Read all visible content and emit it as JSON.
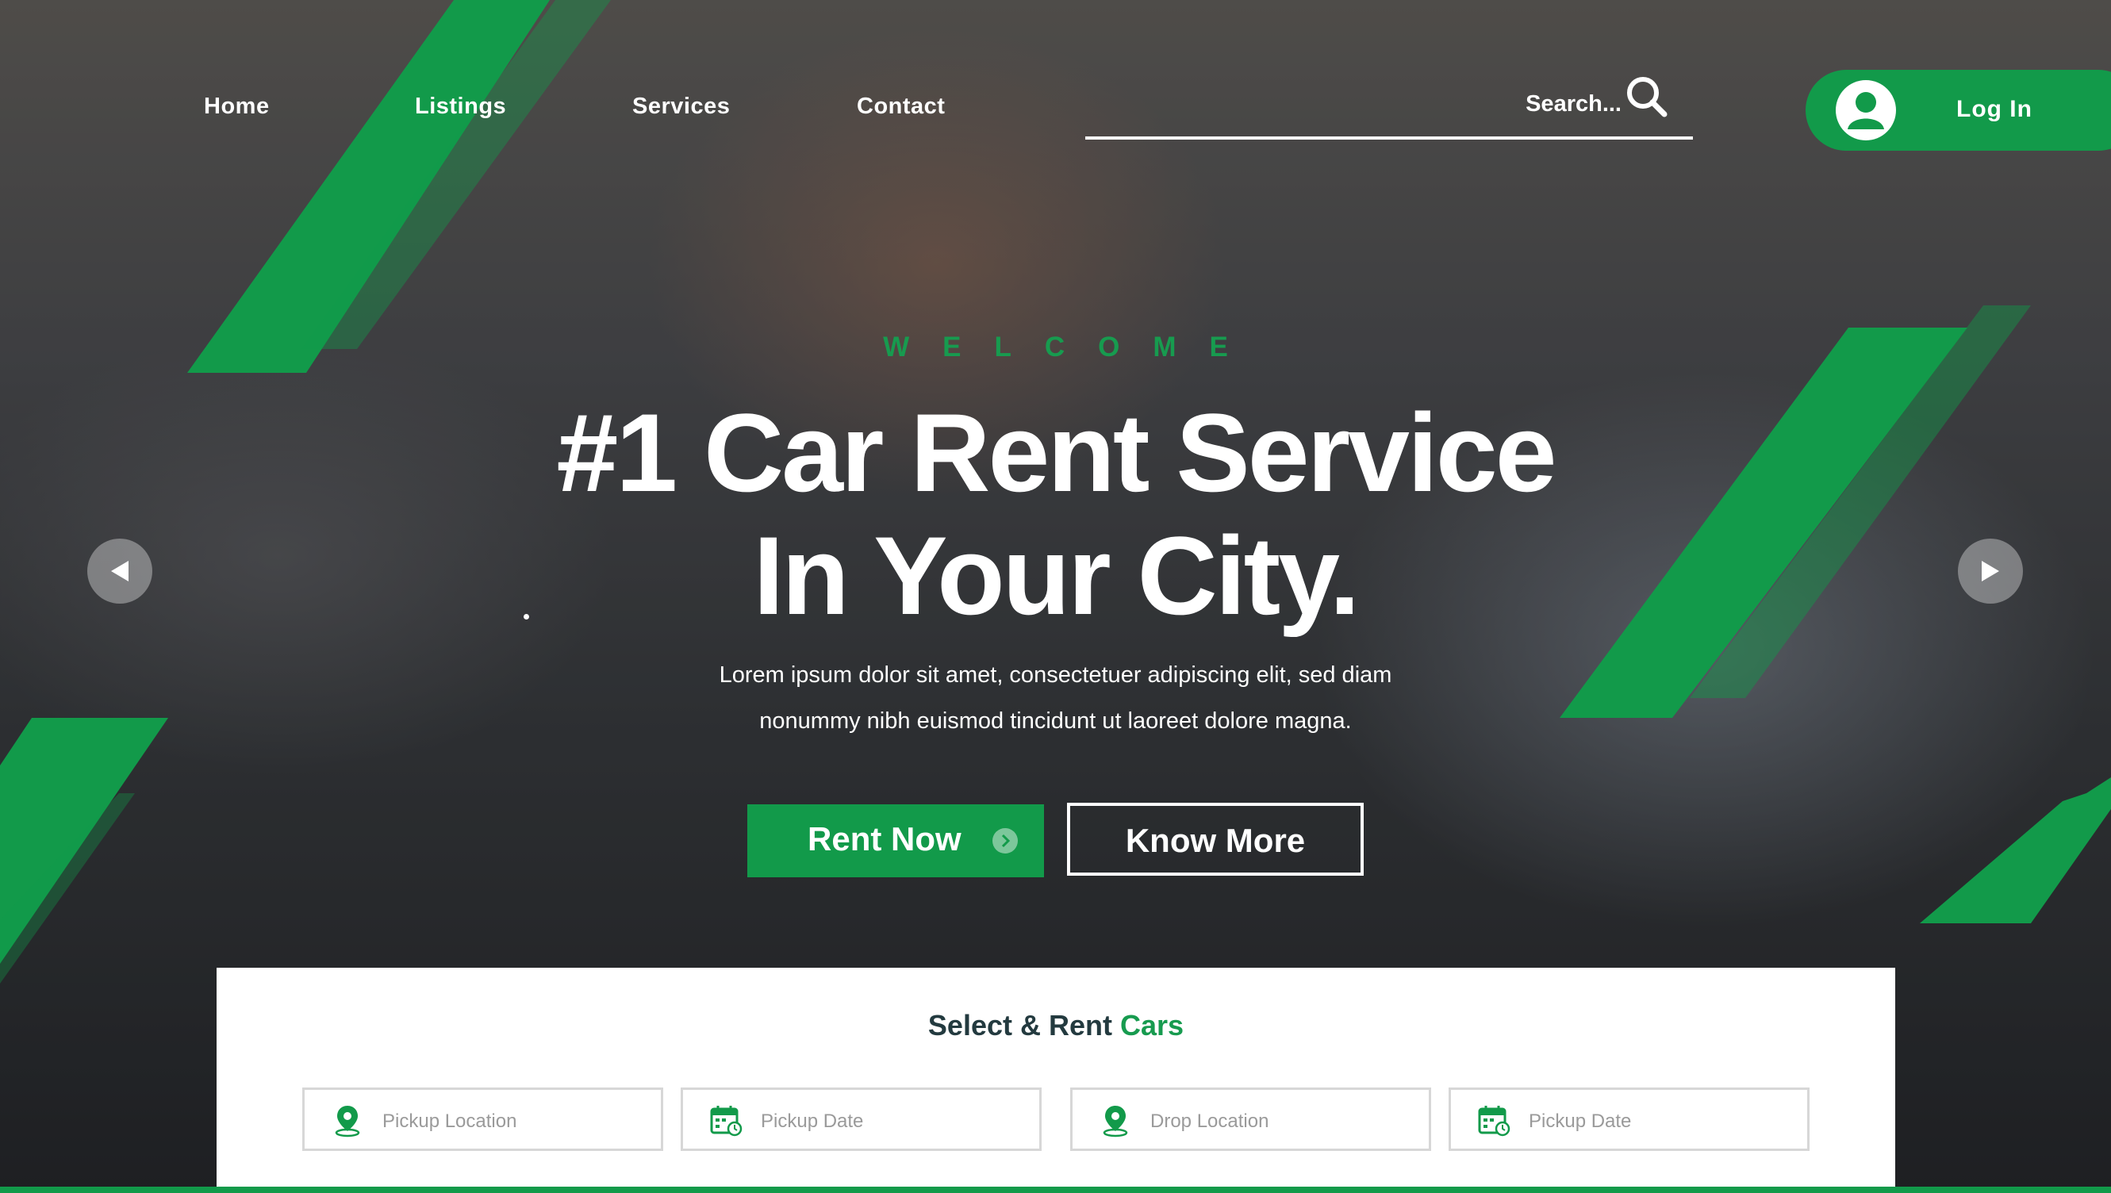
{
  "nav": {
    "links": [
      "Home",
      "Listings",
      "Services",
      "Contact"
    ],
    "search_placeholder": "Search...",
    "login_label": "Log In"
  },
  "hero": {
    "eyebrow": "WELCOME",
    "headline_line1": "#1 Car Rent Service",
    "headline_line2": "In Your City.",
    "lead_line1": "Lorem ipsum dolor sit amet, consectetuer adipiscing elit, sed diam",
    "lead_line2": "nonummy nibh euismod tincidunt ut laoreet dolore magna.",
    "primary_button": "Rent Now",
    "secondary_button": "Know More"
  },
  "booking": {
    "title_main": "Select & Rent",
    "title_accent": "Cars",
    "fields": [
      {
        "label": "Pickup Location",
        "icon": "location-pin-icon"
      },
      {
        "label": "Pickup Date",
        "icon": "calendar-icon"
      },
      {
        "label": "Drop Location",
        "icon": "location-pin-icon"
      },
      {
        "label": "Pickup Date",
        "icon": "calendar-icon"
      }
    ]
  },
  "colors": {
    "brand_green": "#129a4a",
    "accent_green": "#179b4f",
    "title_dark": "#233a3f",
    "field_text": "#9a9a9a"
  }
}
